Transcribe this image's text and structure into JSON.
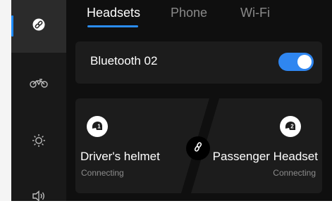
{
  "tabs": [
    {
      "label": "Headsets",
      "active": true
    },
    {
      "label": "Phone",
      "active": false
    },
    {
      "label": "Wi-Fi",
      "active": false
    }
  ],
  "sidebar": {
    "items": [
      {
        "icon": "link-icon",
        "active": true
      },
      {
        "icon": "motorcycle-icon",
        "active": false
      },
      {
        "icon": "brightness-icon",
        "active": false
      },
      {
        "icon": "volume-icon",
        "active": false
      }
    ]
  },
  "device": {
    "name": "Bluetooth 02",
    "enabled": true
  },
  "pairing": {
    "driver": {
      "badge": "1",
      "title": "Driver's helmet",
      "status": "Connecting"
    },
    "passenger": {
      "badge": "2",
      "title": "Passenger Headset",
      "status": "Connecting"
    }
  },
  "colors": {
    "accent": "#2b8df2",
    "sidebar_bg": "#191919",
    "main_bg": "#0f0f0f",
    "card_bg": "#1c1c1c",
    "status_text": "#8c8c8c"
  }
}
